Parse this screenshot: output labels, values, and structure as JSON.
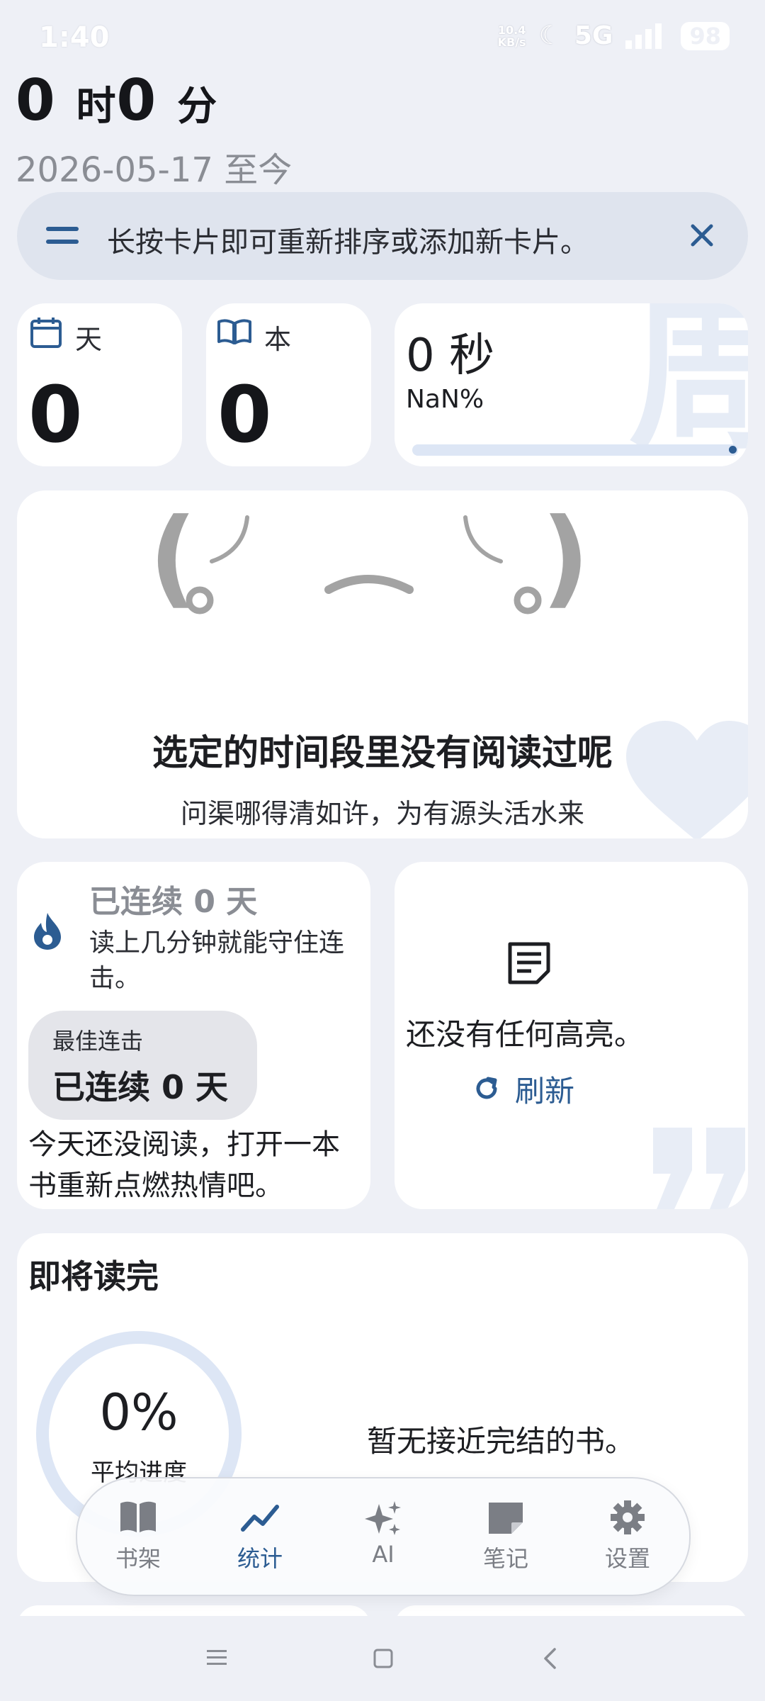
{
  "status_bar": {
    "time": "1:40",
    "net_speed_top": "10.4",
    "net_speed_bottom": "KB/s",
    "network": "5G",
    "battery": "98"
  },
  "header": {
    "time_hours": "0",
    "time_hours_unit": "时",
    "time_minutes": "0",
    "time_minutes_unit": "分",
    "date_range": "2026-05-17 至今"
  },
  "tip": {
    "text": "长按卡片即可重新排序或添加新卡片。"
  },
  "stats": {
    "days_label": "天",
    "days_value": "0",
    "books_label": "本",
    "books_value": "0",
    "seconds_value": "0 秒",
    "percent": "NaN%",
    "progress_fraction": 0.0,
    "week_glyph": "周"
  },
  "empty_state": {
    "kaomoji_left": "(",
    "kaomoji_right": ")",
    "title": "选定的时间段里没有阅读过呢",
    "subtitle": "问渠哪得清如许，为有源头活水来"
  },
  "streak": {
    "title": "已连续 0 天",
    "hint": "读上几分钟就能守住连击。",
    "best_label": "最佳连击",
    "best_value": "已连续 0 天",
    "message": "今天还没阅读，打开一本书重新点燃热情吧。"
  },
  "highlights": {
    "empty_text": "还没有任何高亮。",
    "refresh_label": "刷新"
  },
  "finishing": {
    "title": "即将读完",
    "percent": "0%",
    "avg_label": "平均进度",
    "empty_text": "暂无接近完结的书。"
  },
  "bottom_nav": {
    "items": [
      {
        "label": "书架",
        "icon": "book-icon"
      },
      {
        "label": "统计",
        "icon": "trend-icon"
      },
      {
        "label": "AI",
        "icon": "sparkle-icon"
      },
      {
        "label": "笔记",
        "icon": "note-icon"
      },
      {
        "label": "设置",
        "icon": "gear-icon"
      }
    ],
    "active_index": 1
  },
  "colors": {
    "background": "#eef0f6",
    "accent": "#2c5c92",
    "card": "#ffffff",
    "progress_track": "#dde6f5"
  }
}
